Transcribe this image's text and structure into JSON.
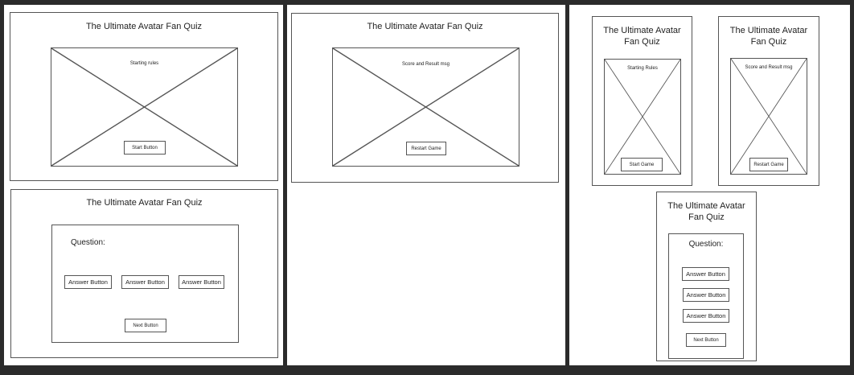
{
  "colors": {
    "background": "#2b2b2b",
    "panel": "#ffffff",
    "stroke": "#555555",
    "text": "#222222"
  },
  "desktop_start": {
    "title": "The Ultimate Avatar Fan Quiz",
    "content_label": "Starting rules",
    "button_label": "Start Button"
  },
  "desktop_quiz": {
    "title": "The Ultimate Avatar Fan Quiz",
    "question_label": "Question:",
    "answers": [
      "Answer Button",
      "Answer Button",
      "Answer Button"
    ],
    "next_label": "Next Button"
  },
  "desktop_result": {
    "title": "The Ultimate Avatar Fan Quiz",
    "content_label": "Score and Result msg",
    "button_label": "Restart Game"
  },
  "mobile_start": {
    "title_line1": "The Ultimate Avatar",
    "title_line2": "Fan Quiz",
    "content_label": "Starting Rules",
    "button_label": "Start Game"
  },
  "mobile_result": {
    "title_line1": "The Ultimate Avatar",
    "title_line2": "Fan Quiz",
    "content_label": "Score and Result msg",
    "button_label": "Restart Game"
  },
  "mobile_quiz": {
    "title_line1": "The Ultimate Avatar",
    "title_line2": "Fan Quiz",
    "question_label": "Question:",
    "answers": [
      "Answer Button",
      "Answer Button",
      "Answer Button"
    ],
    "next_label": "Next Button"
  }
}
